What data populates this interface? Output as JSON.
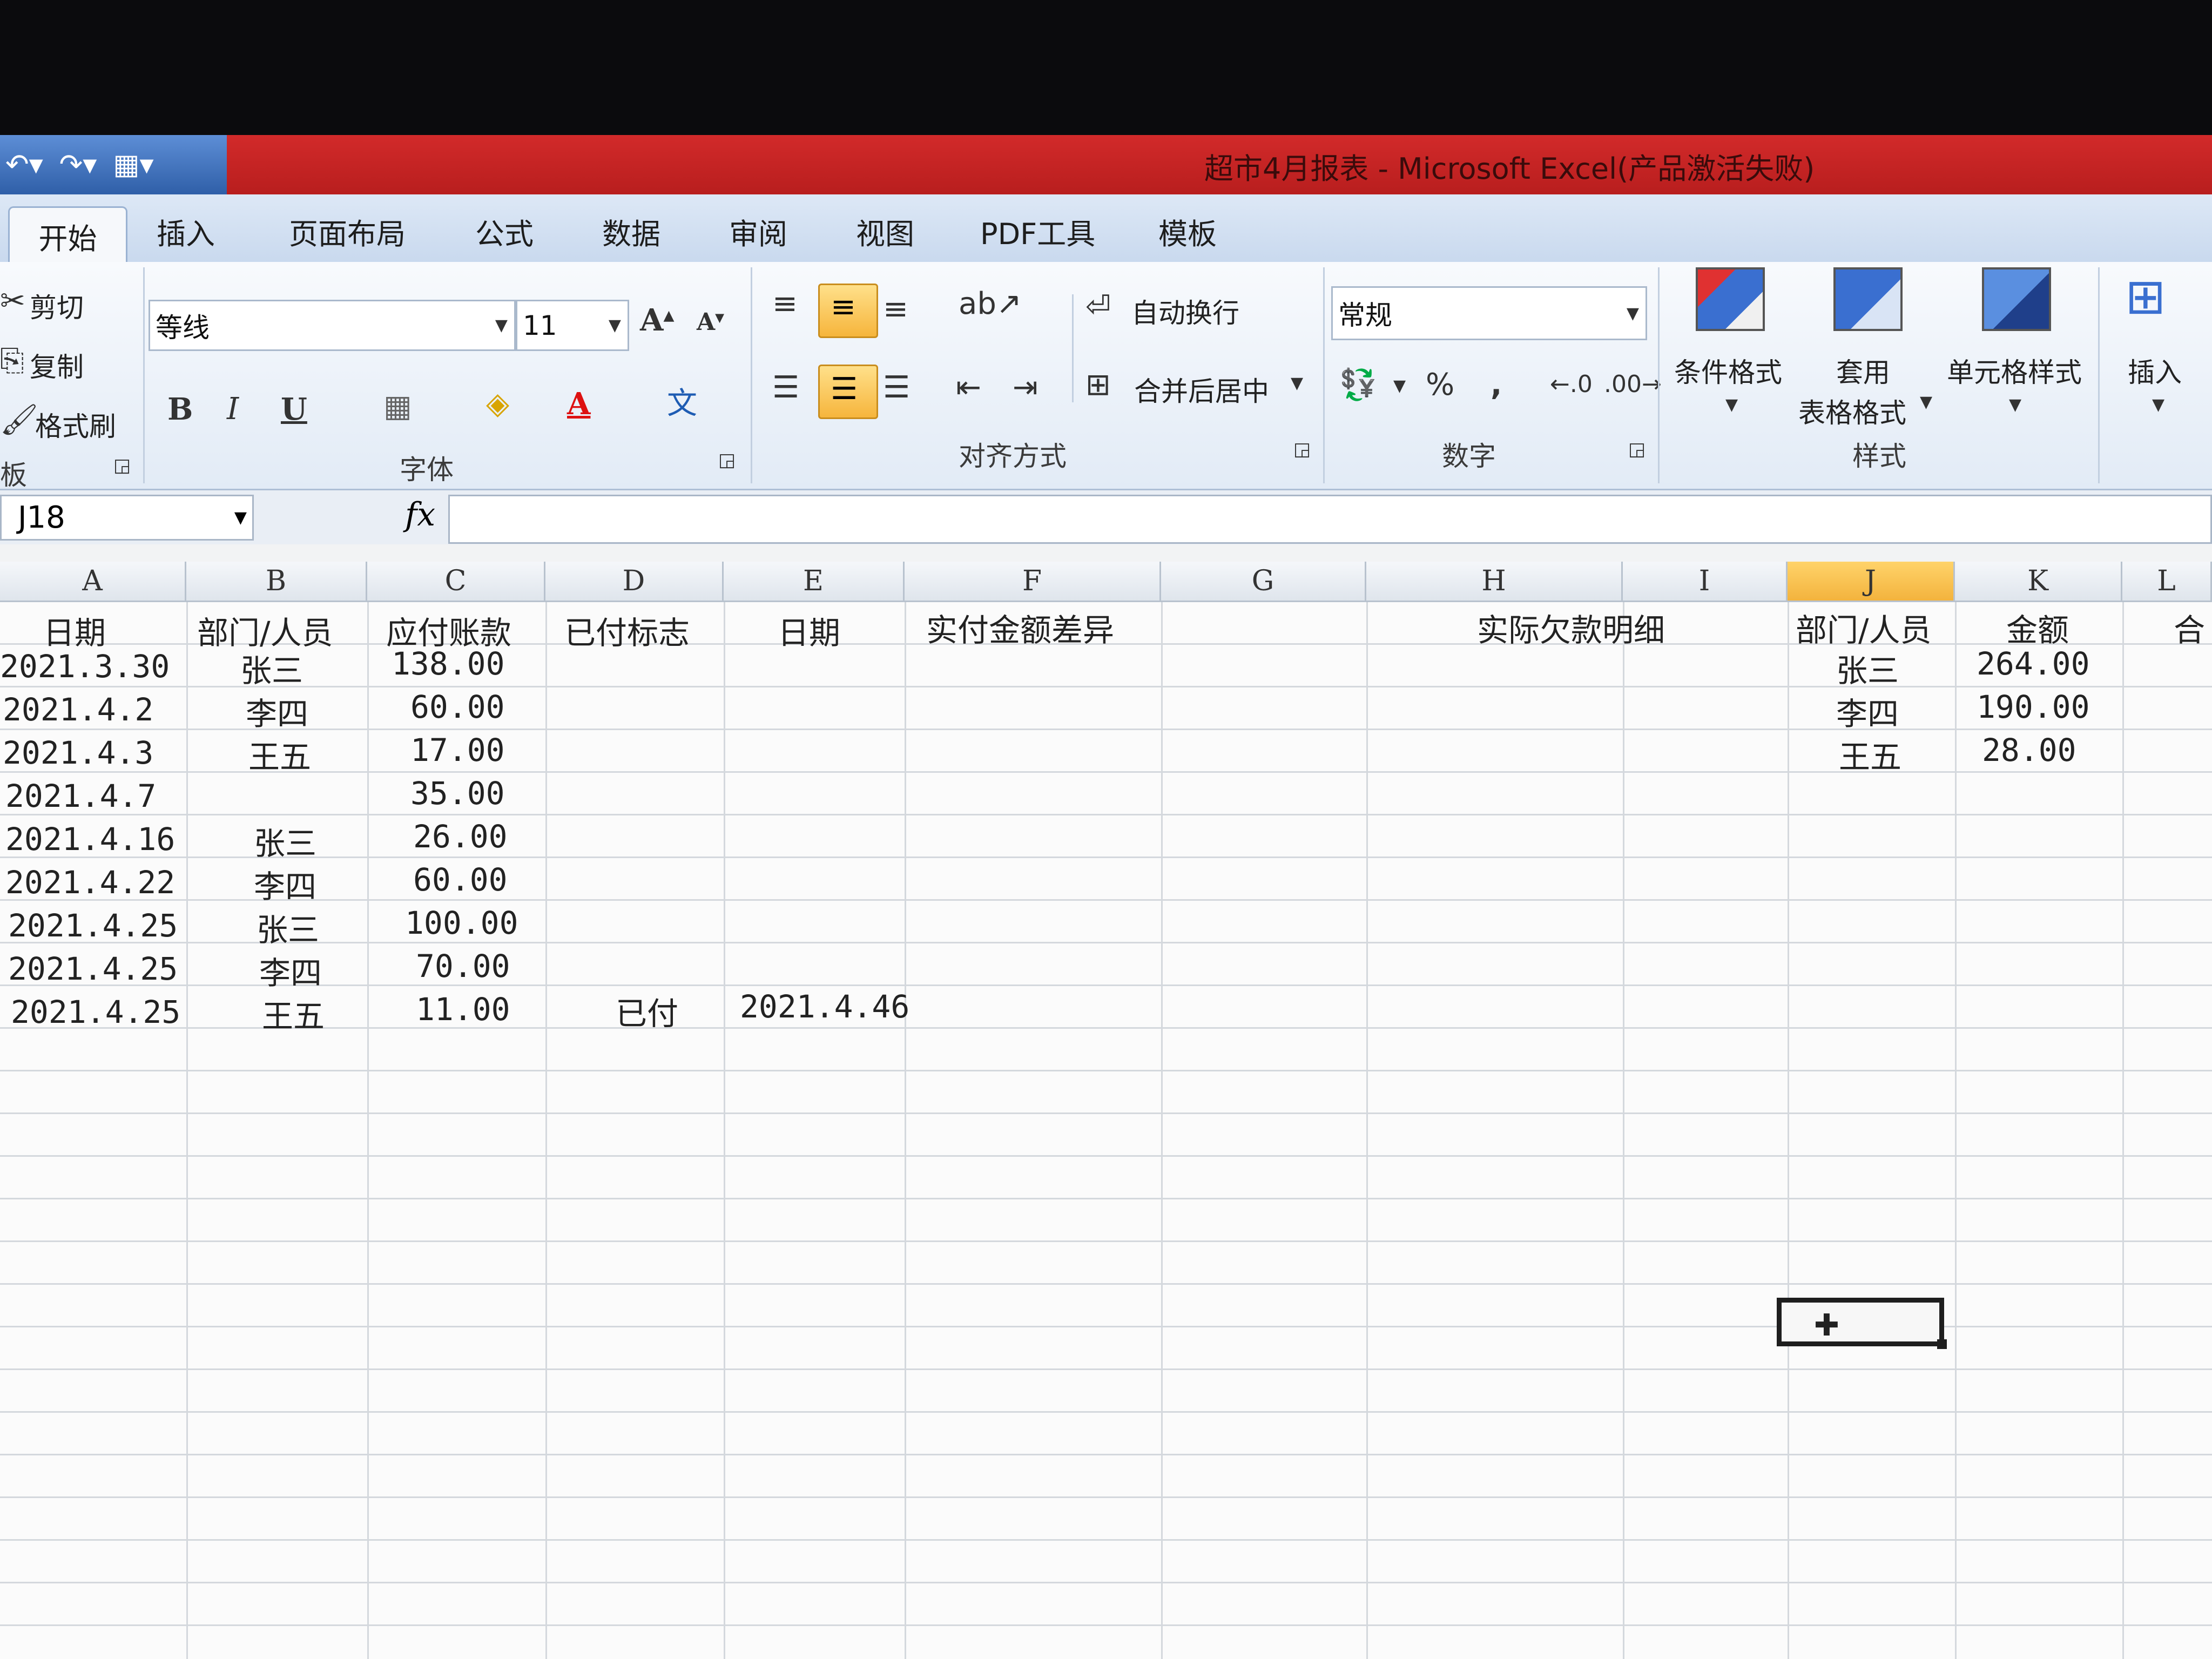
{
  "window": {
    "title": "超市4月报表 - Microsoft Excel(产品激活失败)",
    "qat_icons": [
      "undo-icon",
      "redo-icon",
      "customize-icon"
    ]
  },
  "tabs": [
    "开始",
    "插入",
    "页面布局",
    "公式",
    "数据",
    "审阅",
    "视图",
    "PDF工具",
    "模板"
  ],
  "ribbon": {
    "clipboard": {
      "cut": "剪切",
      "copy": "复制",
      "format_painter": "格式刷",
      "label": "板"
    },
    "font": {
      "font_name": "等线",
      "font_size": "11",
      "bold": "B",
      "italic": "I",
      "underline": "U",
      "font_color_glyph": "A",
      "grow_glyph": "A",
      "shrink_glyph": "A",
      "label": "字体"
    },
    "alignment": {
      "wrap_text": "自动换行",
      "merge_center": "合并后居中",
      "label": "对齐方式"
    },
    "number": {
      "format": "常规",
      "percent": "%",
      "comma": ",",
      "label": "数字"
    },
    "styles": {
      "conditional": "条件格式",
      "table_line1": "套用",
      "table_line2": "表格格式",
      "cell_styles": "单元格样式",
      "label": "样式"
    },
    "cells": {
      "insert": "插入"
    },
    "accent_color": "#f6b53c"
  },
  "formula_bar": {
    "name_box": "J18",
    "fx": "fx",
    "formula": ""
  },
  "sheet": {
    "columns": [
      "A",
      "B",
      "C",
      "D",
      "E",
      "F",
      "G",
      "H",
      "I",
      "J",
      "K",
      "L"
    ],
    "selected_column": "J",
    "headers": {
      "A": "日期",
      "B": "部门/人员",
      "C": "应付账款",
      "D": "已付标志",
      "E": "日期",
      "F": "实付金额差异",
      "H": "实际欠款明细",
      "J": "部门/人员",
      "K": "金额",
      "L": "合"
    },
    "rows": [
      {
        "date": "2021.3.30",
        "person": "张三",
        "amount": "138.00"
      },
      {
        "date": "2021.4.2",
        "person": "李四",
        "amount": "60.00"
      },
      {
        "date": "2021.4.3",
        "person": "王五",
        "amount": "17.00"
      },
      {
        "date": "2021.4.7",
        "person": "",
        "amount": "35.00"
      },
      {
        "date": "2021.4.16",
        "person": "张三",
        "amount": "26.00"
      },
      {
        "date": "2021.4.22",
        "person": "李四",
        "amount": "60.00"
      },
      {
        "date": "2021.4.25",
        "person": "张三",
        "amount": "100.00"
      },
      {
        "date": "2021.4.25",
        "person": "李四",
        "amount": "70.00"
      },
      {
        "date": "2021.4.25",
        "person": "王五",
        "amount": "11.00",
        "paid": "已付",
        "paid_date": "2021.4.46"
      }
    ],
    "summary": [
      {
        "person": "张三",
        "amount": "264.00"
      },
      {
        "person": "李四",
        "amount": "190.00"
      },
      {
        "person": "王五",
        "amount": "28.00"
      }
    ]
  }
}
